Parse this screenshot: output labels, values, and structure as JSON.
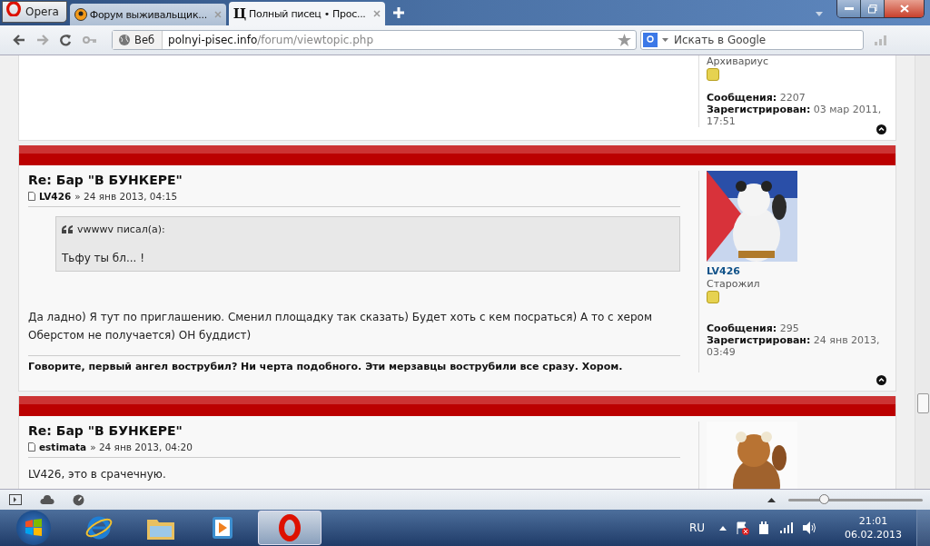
{
  "browser": {
    "menu_button": "Opera",
    "tabs": [
      {
        "title": "Форум выживальщик...",
        "kind": "round",
        "selected": false
      },
      {
        "title": "Полный писец • Прос...",
        "kind": "letter",
        "favicon": "Ц",
        "selected": true
      }
    ],
    "address": {
      "badge": "Веб",
      "domain": "polnyi-pisec.info",
      "path": "/forum/viewtopic.php"
    },
    "search": {
      "placeholder": "Искать в Google"
    }
  },
  "posts": [
    {
      "profile": {
        "rank": "Архивариус",
        "posts_label": "Сообщения:",
        "posts": "2207",
        "reg_label": "Зарегистрирован:",
        "reg": "03 мар 2011, 17:51"
      }
    },
    {
      "title": "Re: Бар \"В БУНКЕРЕ\"",
      "author": "LV426",
      "date": "» 24 янв 2013, 04:15",
      "quote": {
        "author": "vwwwv писал(a):",
        "text": "Тьфу ты бл... !"
      },
      "text": "Да ладно) Я тут по приглашению. Сменил площадку так сказать) Будет хоть с кем посраться) А то с хером Оберстом не получается) ОН буддист)",
      "signature": "Говорите, первый ангел вострубил? Ни черта подобного. Эти мерзавцы вострубили все сразу. Хором.",
      "profile": {
        "name": "LV426",
        "rank": "Старожил",
        "posts_label": "Сообщения:",
        "posts": "295",
        "reg_label": "Зарегистрирован:",
        "reg": "24 янв 2013, 03:49"
      }
    },
    {
      "title": "Re: Бар \"В БУНКЕРЕ\"",
      "author": "estimata",
      "date": "» 24 янв 2013, 04:20",
      "text": "LV426, это в срачечную."
    }
  ],
  "status_bar": {
    "zoom": {
      "level": 0.27
    }
  },
  "taskbar": {
    "apps": [
      {
        "kind": "ie",
        "selected": false
      },
      {
        "kind": "folder",
        "selected": false
      },
      {
        "kind": "media",
        "selected": false
      },
      {
        "kind": "opera",
        "selected": true
      }
    ],
    "language": "RU",
    "time": "21:01",
    "date": "06.02.2013"
  }
}
